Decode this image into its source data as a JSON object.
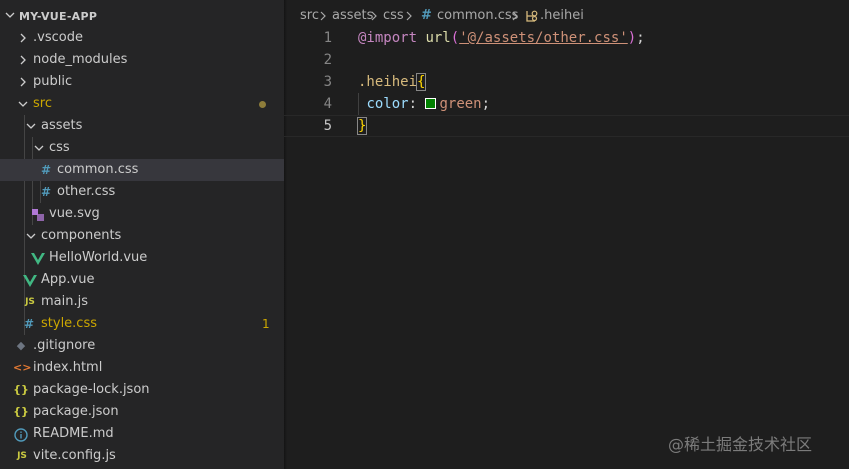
{
  "explorer": {
    "root_title": "MY-VUE-APP",
    "items": [
      {
        "label": ".vscode"
      },
      {
        "label": "node_modules"
      },
      {
        "label": "public"
      },
      {
        "label": "src"
      },
      {
        "label": "assets"
      },
      {
        "label": "css"
      },
      {
        "label": "common.css"
      },
      {
        "label": "other.css"
      },
      {
        "label": "vue.svg"
      },
      {
        "label": "components"
      },
      {
        "label": "HelloWorld.vue"
      },
      {
        "label": "App.vue"
      },
      {
        "label": "main.js"
      },
      {
        "label": "style.css",
        "badge": "1"
      },
      {
        "label": ".gitignore"
      },
      {
        "label": "index.html"
      },
      {
        "label": "package-lock.json"
      },
      {
        "label": "package.json"
      },
      {
        "label": "README.md"
      },
      {
        "label": "vite.config.js"
      }
    ],
    "icons": {
      "css": "#",
      "js": "JS",
      "json": "{}",
      "html": "<>",
      "info": "i",
      "git": "◆"
    }
  },
  "breadcrumbs": {
    "src": "src",
    "assets": "assets",
    "css": "css",
    "file": "common.css",
    "file_icon": "#",
    "symbol": ".heihei"
  },
  "code": {
    "line_numbers": [
      "1",
      "2",
      "3",
      "4",
      "5"
    ],
    "line1": {
      "kw": "@import",
      "fn": "url",
      "open": "(",
      "str": "'@/assets/other.css'",
      "close": ")",
      "end": ";"
    },
    "line3": {
      "sel": ".heihei",
      "brace": "{"
    },
    "line4": {
      "prop": "color",
      "colon": ":",
      "val": "green",
      "end": ";"
    },
    "line5": {
      "brace": "}"
    }
  },
  "colors": {
    "swatch": "#008000",
    "css_icon": "#519aba",
    "js_icon": "#cbcb41",
    "json_icon": "#cbcb41",
    "vue_icon": "#41b883",
    "html_icon": "#e37933",
    "modified": "#cca700"
  },
  "watermark": "@稀土掘金技术社区"
}
